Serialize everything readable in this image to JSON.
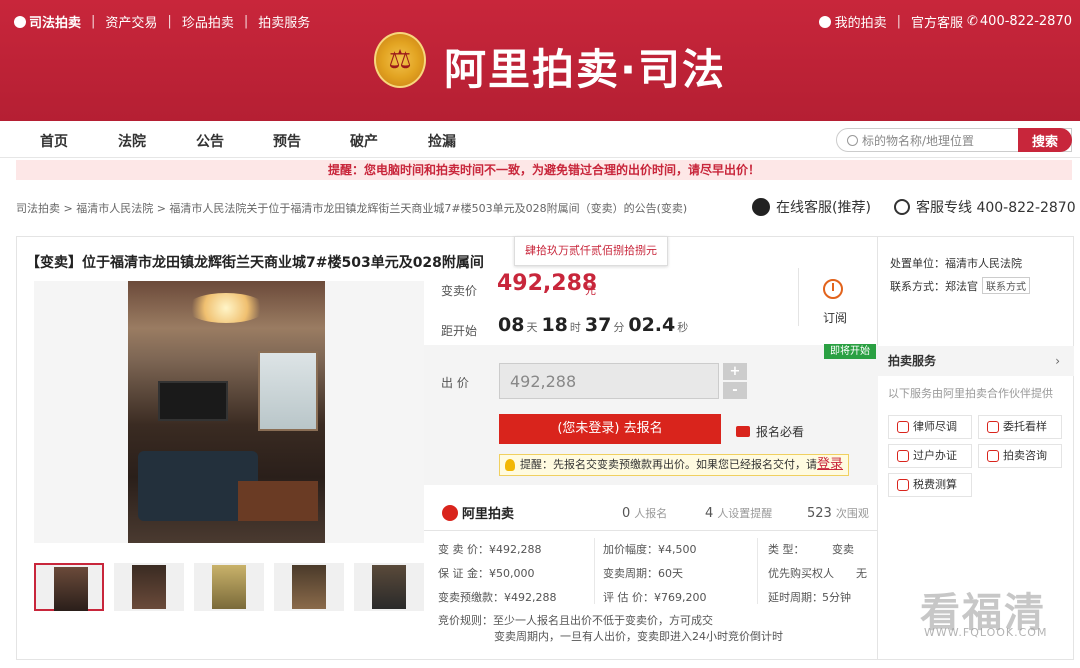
{
  "topbar": {
    "brand": "司法拍卖",
    "links": [
      "资产交易",
      "珍品拍卖",
      "拍卖服务"
    ],
    "my_auction": "我的拍卖",
    "official_service": "官方客服",
    "phone": "400-822-2870"
  },
  "logo": {
    "text": "阿里拍卖·司法"
  },
  "mainnav": [
    "首页",
    "法院",
    "公告",
    "预告",
    "破产",
    "捡漏"
  ],
  "search": {
    "placeholder": "标的物名称/地理位置",
    "button": "搜索"
  },
  "notice": "提醒：您电脑时间和拍卖时间不一致，为避免错过合理的出价时间，请尽早出价！",
  "breadcrumb": "司法拍卖 > 福清市人民法院 > 福清市人民法院关于位于福清市龙田镇龙辉街兰天商业城7#楼503单元及028附属间（变卖）的公告(变卖)",
  "service": {
    "online": "在线客服(推荐)",
    "hotline": "客服专线 400-822-2870"
  },
  "item": {
    "title": "【变卖】位于福清市龙田镇龙辉街兰天商业城7#楼503单元及028附属间",
    "price_capital": "肆拾玖万贰仟贰佰捌拾捌元",
    "price_label": "变卖价",
    "price": "492,288",
    "price_unit": "元",
    "countdown_label": "距开始",
    "countdown": {
      "days": "08",
      "days_unit": "天",
      "hours": "18",
      "hours_unit": "时",
      "minutes": "37",
      "minutes_unit": "分",
      "seconds": "02.4",
      "seconds_unit": "秒"
    },
    "subscribe": "订阅",
    "badge": "即将开始",
    "bid_label": "出 价",
    "bid_value": "492,288",
    "plus": "+",
    "minus": "-",
    "register_button": "(您未登录) 去报名",
    "must_read": "报名必看",
    "tip": "提醒：先报名交变卖预缴款再出价。如果您已经报名交付，请",
    "tip_link": "登录"
  },
  "stats": {
    "brand": "阿里拍卖",
    "signups": "0",
    "signups_label": "人报名",
    "reminders": "4",
    "reminders_label": "人设置提醒",
    "views": "523",
    "views_label": "次围观"
  },
  "info": {
    "col1": [
      "变 卖 价：¥492,288",
      "保 证 金：¥50,000",
      "变卖预缴款：¥492,288"
    ],
    "col2": [
      "加价幅度：¥4,500",
      "变卖周期：60天",
      "评 估 价：¥769,200"
    ],
    "col3_keys": [
      "类 型：",
      "优先购买权人",
      "延时周期："
    ],
    "col3_vals": [
      "变卖",
      "无",
      "5分钟"
    ],
    "rules_label": "竞价规则：",
    "rules": [
      "至少一人报名且出价不低于变卖价，方可成交",
      "变卖周期内，一旦有人出价，变卖即进入24小时竞价倒计时"
    ]
  },
  "side": {
    "unit": "处置单位：福清市人民法院",
    "contact": "联系方式：郑法官",
    "contact_tag": "联系方式",
    "service_title": "拍卖服务",
    "service_note": "以下服务由阿里拍卖合作伙伴提供",
    "buttons": [
      "律师尽调",
      "委托看样",
      "过户办证",
      "拍卖咨询",
      "税费测算"
    ]
  },
  "watermark": {
    "cn": "看福清",
    "url": "WWW.FQLOOK.COM"
  }
}
